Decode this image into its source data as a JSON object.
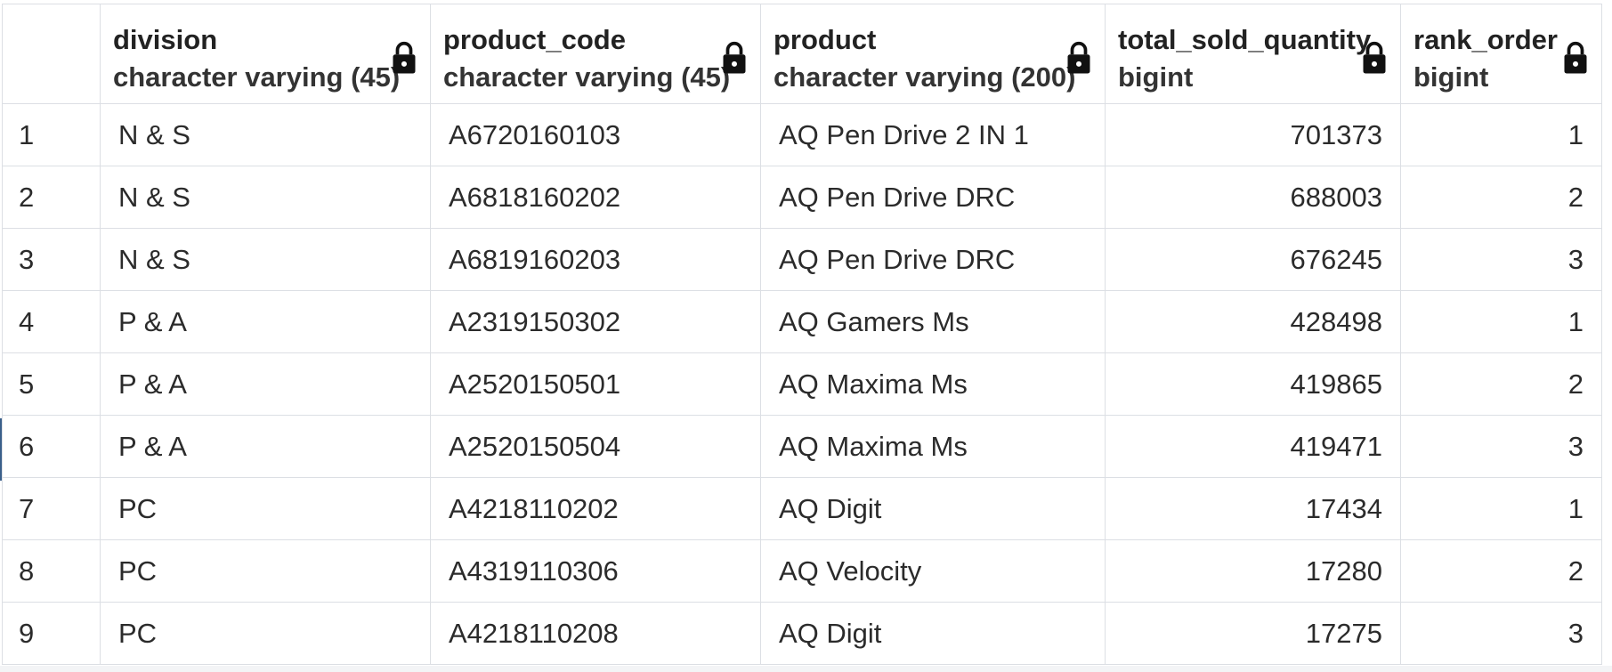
{
  "grid": {
    "columns": [
      {
        "name": "division",
        "type": "character varying (45)",
        "icon": "lock-icon"
      },
      {
        "name": "product_code",
        "type": "character varying (45)",
        "icon": "lock-icon"
      },
      {
        "name": "product",
        "type": "character varying (200)",
        "icon": "lock-icon"
      },
      {
        "name": "total_sold_quantity",
        "type": "bigint",
        "icon": "lock-icon"
      },
      {
        "name": "rank_order",
        "type": "bigint",
        "icon": "lock-icon"
      }
    ],
    "rows": [
      {
        "n": "1",
        "division": "N & S",
        "product_code": "A6720160103",
        "product": "AQ Pen Drive 2 IN 1",
        "total_sold_quantity": "701373",
        "rank_order": "1"
      },
      {
        "n": "2",
        "division": "N & S",
        "product_code": "A6818160202",
        "product": "AQ Pen Drive DRC",
        "total_sold_quantity": "688003",
        "rank_order": "2"
      },
      {
        "n": "3",
        "division": "N & S",
        "product_code": "A6819160203",
        "product": "AQ Pen Drive DRC",
        "total_sold_quantity": "676245",
        "rank_order": "3"
      },
      {
        "n": "4",
        "division": "P & A",
        "product_code": "A2319150302",
        "product": "AQ Gamers Ms",
        "total_sold_quantity": "428498",
        "rank_order": "1"
      },
      {
        "n": "5",
        "division": "P & A",
        "product_code": "A2520150501",
        "product": "AQ Maxima Ms",
        "total_sold_quantity": "419865",
        "rank_order": "2"
      },
      {
        "n": "6",
        "division": "P & A",
        "product_code": "A2520150504",
        "product": "AQ Maxima Ms",
        "total_sold_quantity": "419471",
        "rank_order": "3"
      },
      {
        "n": "7",
        "division": "PC",
        "product_code": "A4218110202",
        "product": "AQ Digit",
        "total_sold_quantity": "17434",
        "rank_order": "1"
      },
      {
        "n": "8",
        "division": "PC",
        "product_code": "A4319110306",
        "product": "AQ Velocity",
        "total_sold_quantity": "17280",
        "rank_order": "2"
      },
      {
        "n": "9",
        "division": "PC",
        "product_code": "A4218110208",
        "product": "AQ Digit",
        "total_sold_quantity": "17275",
        "rank_order": "3"
      }
    ]
  }
}
